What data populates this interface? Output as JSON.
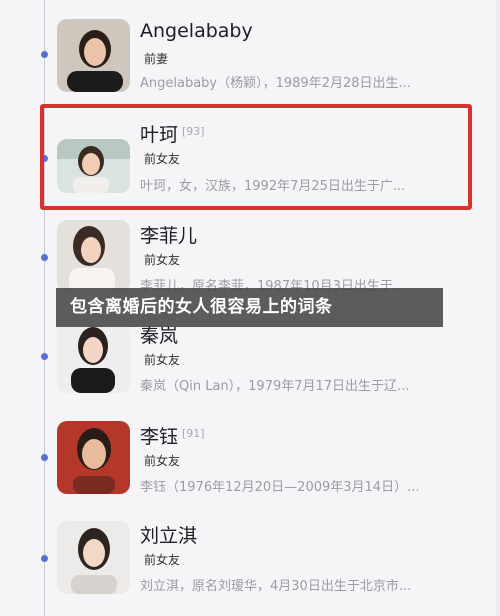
{
  "colors": {
    "timeline_dot": "#5a6fd8",
    "highlight_border": "#d8322e",
    "banner_background": "#424242"
  },
  "entries": [
    {
      "name": "Angelababy",
      "count": "",
      "relation": "前妻",
      "desc": "Angelababy（杨颖），1989年2月28日出生..."
    },
    {
      "name": "叶珂",
      "count": "[93]",
      "relation": "前女友",
      "desc": "叶珂，女，汉族，1992年7月25日出生于广..."
    },
    {
      "name": "李菲儿",
      "count": "",
      "relation": "前女友",
      "desc": "李菲儿，原名李菲，1987年10月3日出生于..."
    },
    {
      "name": "秦岚",
      "count": "",
      "relation": "前女友",
      "desc": "秦岚（Qin Lan），1979年7月17日出生于辽..."
    },
    {
      "name": "李钰",
      "count": "[91]",
      "relation": "前女友",
      "desc": "李钰（1976年12月20日—2009年3月14日）..."
    },
    {
      "name": "刘立淇",
      "count": "",
      "relation": "前女友",
      "desc": "刘立淇，原名刘瑷华，4月30日出生于北京市..."
    }
  ],
  "banner": {
    "text": "包含离婚后的女人很容易上的词条"
  }
}
